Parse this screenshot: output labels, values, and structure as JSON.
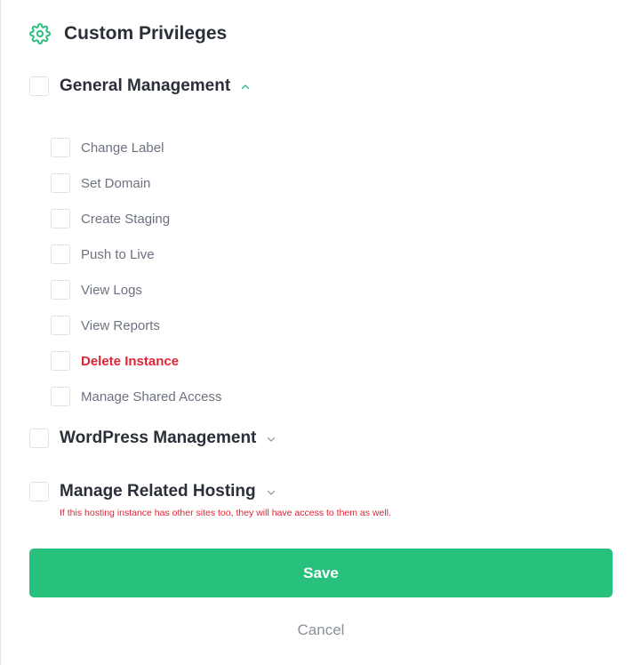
{
  "header": {
    "title": "Custom Privileges",
    "icon": "gear-icon"
  },
  "colors": {
    "accent": "#27c17d",
    "danger": "#e02436",
    "text": "#2b2f3a",
    "muted": "#6c7280"
  },
  "groups": [
    {
      "label": "General Management",
      "checked": false,
      "expanded": true,
      "chevron": "chevron-up-icon",
      "items": [
        {
          "label": "Change Label",
          "checked": false,
          "danger": false
        },
        {
          "label": "Set Domain",
          "checked": false,
          "danger": false
        },
        {
          "label": "Create Staging",
          "checked": false,
          "danger": false
        },
        {
          "label": "Push to Live",
          "checked": false,
          "danger": false
        },
        {
          "label": "View Logs",
          "checked": false,
          "danger": false
        },
        {
          "label": "View Reports",
          "checked": false,
          "danger": false
        },
        {
          "label": "Delete Instance",
          "checked": false,
          "danger": true
        },
        {
          "label": "Manage Shared Access",
          "checked": false,
          "danger": false
        }
      ]
    },
    {
      "label": "WordPress Management",
      "checked": false,
      "expanded": false,
      "chevron": "chevron-down-icon"
    },
    {
      "label": "Manage Related Hosting",
      "checked": false,
      "expanded": false,
      "chevron": "chevron-down-icon",
      "warning": "If this hosting instance has other sites too, they will have access to them as well."
    }
  ],
  "actions": {
    "save_label": "Save",
    "cancel_label": "Cancel"
  }
}
